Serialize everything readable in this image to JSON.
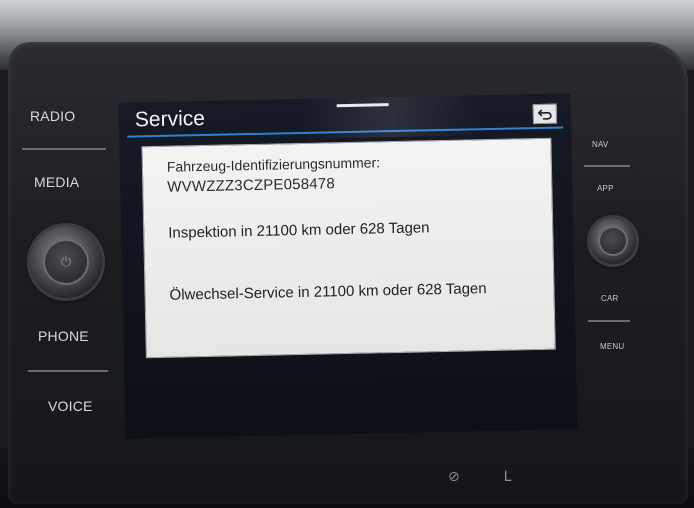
{
  "hardware": {
    "left_buttons": [
      "RADIO",
      "MEDIA",
      "PHONE",
      "VOICE"
    ],
    "right_buttons": [
      "NAV",
      "APP",
      "CAR",
      "MENU"
    ]
  },
  "screen": {
    "title": "Service",
    "back_icon": "back-arrow-icon",
    "vin_label": "Fahrzeug-Identifizierungsnummer:",
    "vin_value": "WVWZZZ3CZPE058478",
    "inspection": "Inspektion in 21100 km oder 628 Tagen",
    "oil_service": "Ölwechsel-Service in 21100 km oder 628 Tagen"
  },
  "colors": {
    "accent": "#2f7fd6",
    "screen_bg": "#0d0f17",
    "panel_bg": "#eeeeed"
  }
}
